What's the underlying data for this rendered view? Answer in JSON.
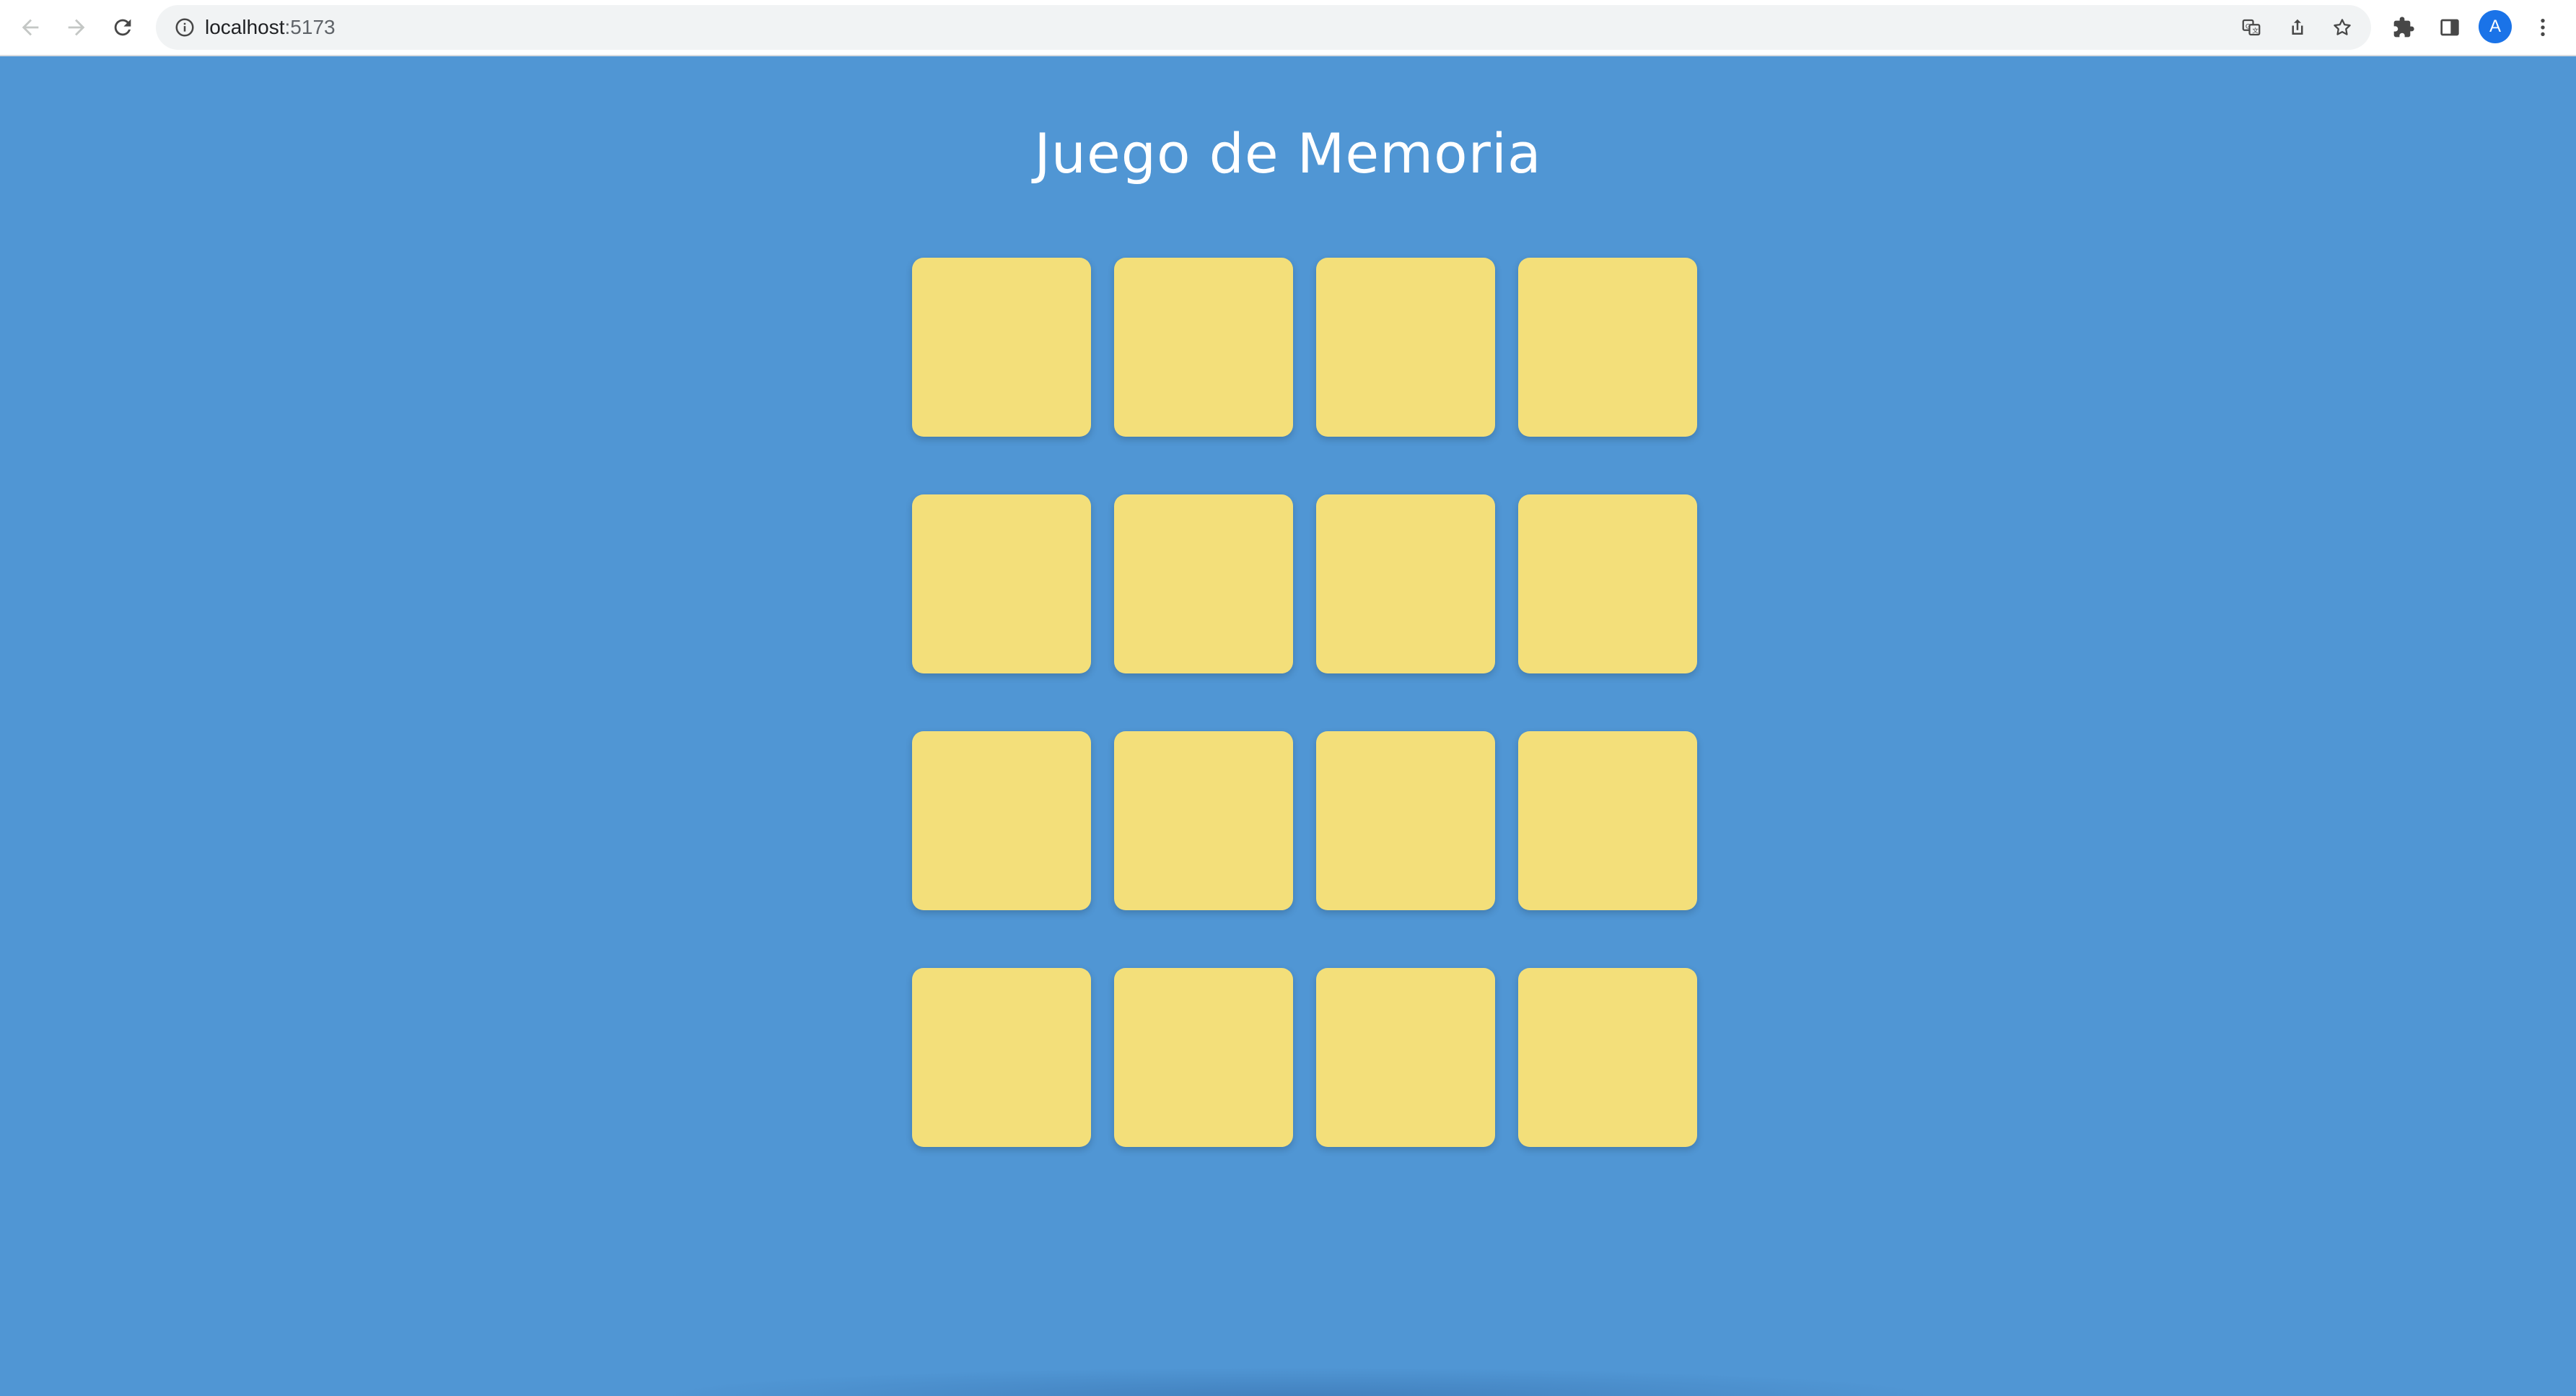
{
  "browser": {
    "url_host": "localhost",
    "url_port": ":5173",
    "profile_initial": "A",
    "icons": {
      "back": "back-arrow-icon",
      "forward": "forward-arrow-icon",
      "reload": "reload-icon",
      "site_info": "info-icon",
      "translate": "translate-icon",
      "share": "share-icon",
      "bookmark": "star-icon",
      "extensions": "puzzle-icon",
      "side_panel": "side-panel-icon",
      "menu": "kebab-menu-icon"
    }
  },
  "game": {
    "title": "Juego de Memoria",
    "card_color": "#f3df7a",
    "background_color": "#5096d4",
    "rows": 4,
    "columns": 4,
    "cards_face_down": 16
  }
}
